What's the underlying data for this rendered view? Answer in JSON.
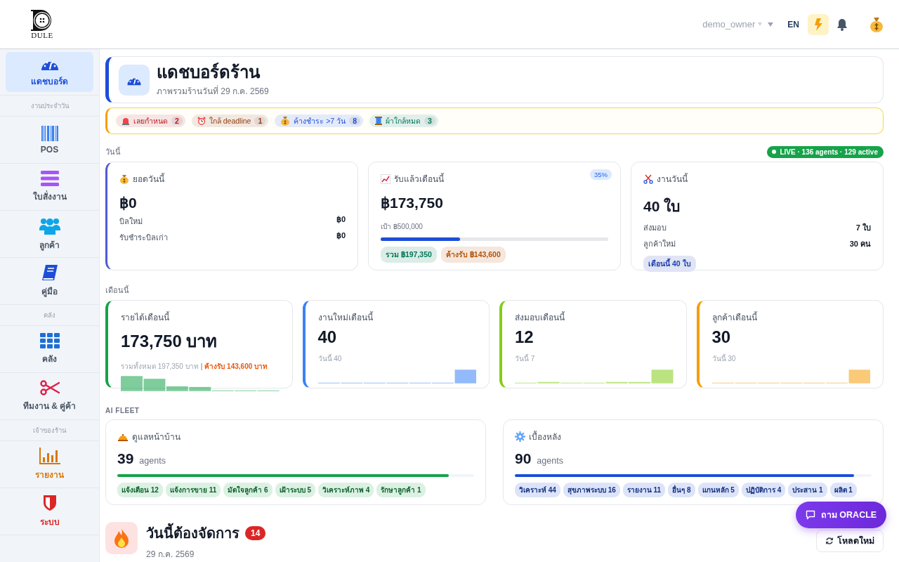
{
  "header": {
    "logo": "DULE",
    "user": "demo_owner",
    "language": "EN"
  },
  "sidebar": {
    "items": [
      {
        "kind": "item",
        "label": "แดชบอร์ด",
        "selected": true,
        "highlight": false,
        "color": "#1d4ed8"
      },
      {
        "kind": "section",
        "label": "งานประจำวัน"
      },
      {
        "kind": "item",
        "label": "POS",
        "selected": false,
        "highlight": false,
        "color": "#3b82f6"
      },
      {
        "kind": "item",
        "label": "ใบสั่งงาน",
        "selected": false,
        "highlight": false,
        "color": "#a855f7"
      },
      {
        "kind": "item",
        "label": "ลูกค้า",
        "selected": false,
        "highlight": false,
        "color": "#0ea5e9"
      },
      {
        "kind": "item",
        "label": "คู่มือ",
        "selected": false,
        "highlight": false,
        "color": "#1d4ed8"
      },
      {
        "kind": "section",
        "label": "คลัง"
      },
      {
        "kind": "item",
        "label": "คลัง",
        "selected": false,
        "highlight": false,
        "color": "#1d6fd8"
      },
      {
        "kind": "item",
        "label": "ทีมงาน & คู่ค้า",
        "selected": false,
        "highlight": false,
        "color": "#e11d48"
      },
      {
        "kind": "section",
        "label": "เจ้าของร้าน"
      },
      {
        "kind": "item",
        "label": "รายงาน",
        "selected": false,
        "highlight": true,
        "color": "#d97706"
      },
      {
        "kind": "item",
        "label": "ระบบ",
        "selected": false,
        "highlight": true,
        "color": "#dc2626"
      }
    ]
  },
  "title_card": {
    "title": "แดชบอร์ดร้าน",
    "subtitle": "ภาพรวมร้านวันที่ 29 ก.ค. 2569"
  },
  "alerts": [
    {
      "label": "เลยกำหนด",
      "count": "2",
      "color": "#b91c1c"
    },
    {
      "label": "ใกล้ deadline",
      "count": "1",
      "color": "#92400e"
    },
    {
      "label": "ค้างชำระ >7 วัน",
      "count": "8",
      "color": "#1d4ed8"
    },
    {
      "label": "ผ้าใกล้หมด",
      "count": "3",
      "color": "#047857"
    }
  ],
  "today": {
    "label": "วันนี้",
    "live": "LIVE · 136 agents · 129 active",
    "cards": [
      {
        "title": "ยอดวันนี้",
        "value": "฿0",
        "color": "#4f5bd5",
        "rows": [
          {
            "label": "บิลใหม่",
            "value": "฿0"
          },
          {
            "label": "รับชำระบิลเก่า",
            "value": "฿0"
          }
        ]
      },
      {
        "title": "รับแล้วเดือนนี้",
        "value": "฿173,750",
        "badge": "35%",
        "note": "เป้า ฿500,000",
        "level": 0.35,
        "tags": [
          {
            "label": "รวม ฿197,350",
            "color": "#047857"
          },
          {
            "label": "ค้างรับ ฿143,600",
            "color": "#b45309"
          }
        ]
      },
      {
        "title": "งานวันนี้",
        "value": "40 ใบ",
        "rows": [
          {
            "label": "ส่งมอบ",
            "value": "7 ใบ"
          },
          {
            "label": "ลูกค้าใหม่",
            "value": "30 คน"
          }
        ],
        "tags": [
          {
            "label": "เดือนนี้ 40 ใบ",
            "color": "#1e40af"
          }
        ]
      }
    ]
  },
  "month": {
    "label": "เดือนนี้",
    "cards": [
      {
        "title": "รายได้เดือนนี้",
        "value": "173,750 บาท",
        "note": "รวมทั้งหมด 197,350 บาท",
        "separator": "|",
        "alert": "ค้างรับ 143,600 บาท",
        "color": "#16a34a"
      },
      {
        "title": "งานใหม่เดือนนี้",
        "value": "40",
        "note": "วันนี้ 40",
        "color": "#3b82f6"
      },
      {
        "title": "ส่งมอบเดือนนี้",
        "value": "12",
        "note": "วันนี้ 7",
        "color": "#84cc16"
      },
      {
        "title": "ลูกค้าเดือนนี้",
        "value": "30",
        "note": "วันนี้ 30",
        "color": "#f59e0b"
      }
    ]
  },
  "fleet": {
    "label": "AI FLEET",
    "cards": [
      {
        "title": "ดูแลหน้าบ้าน",
        "count": "39",
        "unit": "agents",
        "level": 0.93,
        "color": "#16a34a",
        "tags": [
          "แจ้งเตือน 12",
          "แจ้งการขาย 11",
          "มัดใจลูกค้า 6",
          "เฝ้าระบบ 5",
          "วิเคราะห์ภาพ 4",
          "รักษาลูกค้า 1"
        ]
      },
      {
        "title": "เบื้องหลัง",
        "count": "90",
        "unit": "agents",
        "level": 0.95,
        "color": "#1d4ed8",
        "tags": [
          "วิเคราะห์ 44",
          "สุขภาพระบบ 16",
          "รายงาน 11",
          "อื่นๆ 8",
          "แกนหลัก 5",
          "ปฏิบัติการ 4",
          "ประสาน 1",
          "ผลิต 1"
        ]
      }
    ]
  },
  "tasks": {
    "title": "วันนี้ต้องจัดการ",
    "count": "14",
    "date": "29 ก.ค. 2569",
    "reload": "โหลดใหม่"
  },
  "oracle": {
    "label": "ถาม ORACLE"
  }
}
